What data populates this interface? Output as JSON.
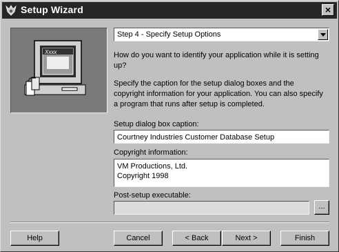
{
  "window": {
    "title": "Setup Wizard",
    "close_label": "×"
  },
  "illustration": {
    "screen_text": "Xxxx"
  },
  "step_select": {
    "value": "Step 4 - Specify Setup Options"
  },
  "content": {
    "question": "How do you want to identify your application while it is setting up?",
    "instruction": "Specify the caption for the setup dialog boxes and the copyright information for your application.       You can also specify a program that runs after setup is completed."
  },
  "caption_field": {
    "label": "Setup dialog box caption:",
    "value": "Courtney Industries Customer Database Setup"
  },
  "copyright_field": {
    "label": "Copyright information:",
    "value": "VM Productions, Ltd.\nCopyright 1998"
  },
  "post_setup_field": {
    "label": "Post-setup executable:",
    "value": "",
    "browse_label": "..."
  },
  "buttons": {
    "help": "Help",
    "cancel": "Cancel",
    "back": "< Back",
    "next": "Next >",
    "finish": "Finish"
  }
}
